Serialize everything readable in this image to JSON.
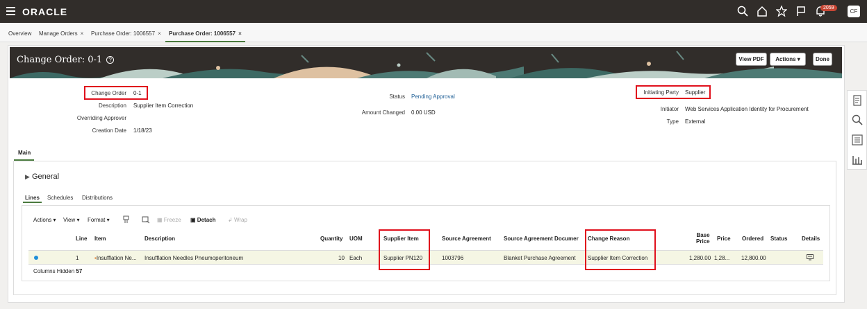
{
  "topbar": {
    "brand": "ORACLE",
    "notification_count": "2059",
    "user_initials": "CF",
    "icons": [
      "hamburger-icon",
      "search-icon",
      "home-icon",
      "star-icon",
      "flag-icon",
      "bell-icon"
    ]
  },
  "tabs": [
    {
      "label": "Overview",
      "closable": false
    },
    {
      "label": "Manage Orders",
      "closable": true
    },
    {
      "label": "Purchase Order: 1006557",
      "closable": true
    },
    {
      "label": "Purchase Order: 1006557",
      "closable": true,
      "active": true
    }
  ],
  "close_glyph": "×",
  "page": {
    "title": "Change Order: 0-1",
    "buttons": {
      "view_pdf": "View PDF",
      "actions": "Actions",
      "done": "Done"
    }
  },
  "header": {
    "change_order_label": "Change Order",
    "change_order_value": "0-1",
    "description_label": "Description",
    "description_value": "Supplier Item Correction",
    "overriding_approver_label": "Overriding Approver",
    "creation_date_label": "Creation Date",
    "creation_date_value": "1/18/23",
    "status_label": "Status",
    "status_value": "Pending Approval",
    "amount_changed_label": "Amount Changed",
    "amount_changed_value": "0.00 USD",
    "initiating_party_label": "Initiating Party",
    "initiating_party_value": "Supplier",
    "initiator_label": "Initiator",
    "initiator_value": "Web Services Application Identity for Procurement",
    "type_label": "Type",
    "type_value": "External"
  },
  "main_tab": "Main",
  "section_general": "General",
  "subtabs": [
    "Lines",
    "Schedules",
    "Distributions"
  ],
  "toolbar": {
    "actions": "Actions",
    "view": "View",
    "format": "Format",
    "freeze": "Freeze",
    "detach": "Detach",
    "wrap": "Wrap"
  },
  "table": {
    "columns": {
      "line": "Line",
      "item": "Item",
      "description": "Description",
      "quantity": "Quantity",
      "uom": "UOM",
      "supplier_item": "Supplier Item",
      "source_agreement": "Source Agreement",
      "source_agreement_document": "Source Agreement Documer",
      "change_reason": "Change Reason",
      "base_price_1": "Base",
      "base_price_2": "Price",
      "price": "Price",
      "ordered": "Ordered",
      "status": "Status",
      "details": "Details"
    },
    "row": {
      "line": "1",
      "item": "Insufflation Ne...",
      "description": "Insufflation Needles Pneumoperitoneum",
      "quantity": "10",
      "uom": "Each",
      "supplier_item": "Supplier PN120",
      "source_agreement": "1003796",
      "source_agreement_document": "Blanket Purchase Agreement",
      "change_reason": "Supplier Item Correction",
      "base_price": "1,280.00",
      "price": "1,28...",
      "ordered": "12,800.00",
      "status": ""
    },
    "columns_hidden_label": "Columns Hidden",
    "columns_hidden_value": "57"
  },
  "colors": {
    "topbar": "#312d2a",
    "accent": "#4a7a3e",
    "link": "#1f5f96",
    "highlight": "#e0101c"
  }
}
